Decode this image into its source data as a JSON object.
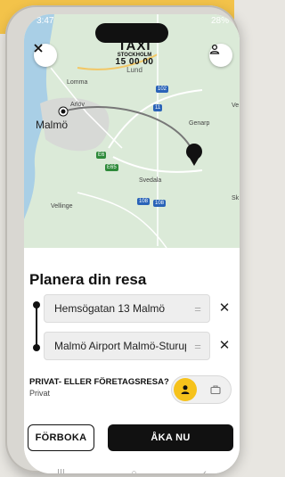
{
  "status_bar": {
    "time": "3:47",
    "right": "28%"
  },
  "map": {
    "logo": {
      "line1": "TAXI",
      "line2": "STOCKHOLM",
      "line3": "15 00 00",
      "line4": "Lund"
    },
    "labels": [
      "Lomma",
      "Arlöv",
      "Malmö",
      "Genarp",
      "Svedala",
      "Vellinge",
      "Ve",
      "Sk"
    ],
    "road_numbers": [
      "102",
      "11",
      "E6",
      "E65",
      "108",
      "108"
    ],
    "colors": {
      "land": "#dbead8",
      "water": "#a9cfe6",
      "route": "#777777"
    }
  },
  "buttons": {
    "close_icon": "close-icon",
    "profile_icon": "person-icon"
  },
  "sheet": {
    "title": "Planera din resa",
    "stops": [
      {
        "address": "Hemsögatan 13 Malmö"
      },
      {
        "address": "Malmö Airport Malmö-Sturup"
      }
    ],
    "drag_glyph": "=",
    "remove_glyph": "✕",
    "purpose_label": "PRIVAT- ELLER FÖRETAGSRESA?",
    "purpose_value": "Privat",
    "prebook_label": "FÖRBOKA",
    "ride_now_label": "ÅKA NU",
    "accent": "#f6c21b"
  },
  "nav": {
    "recent": "|||",
    "home": "○",
    "back": "‹"
  }
}
